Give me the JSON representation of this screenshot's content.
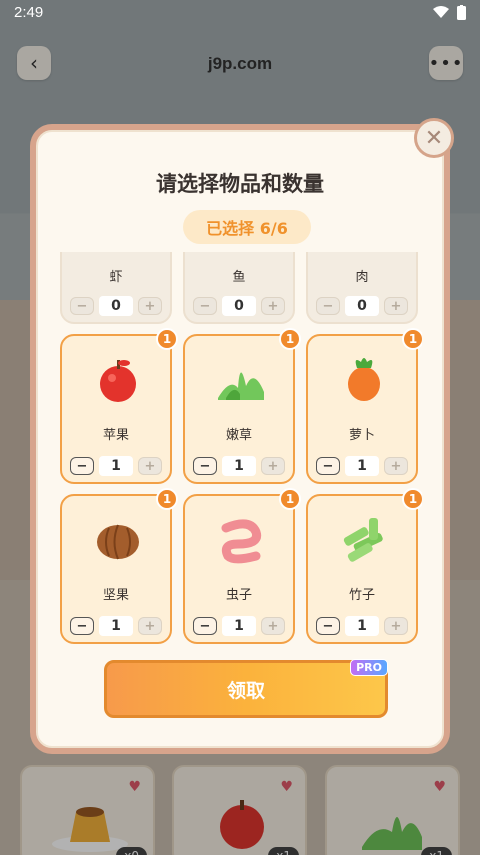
{
  "status_bar": {
    "time": "2:49"
  },
  "top_bar": {
    "domain": "j9p.com"
  },
  "dialog": {
    "title": "请选择物品和数量",
    "selected_text": "已选择 6/6",
    "claim_label": "领取",
    "pro_badge": "PRO",
    "partial_row": [
      {
        "name": "虾",
        "qty": "0"
      },
      {
        "name": "鱼",
        "qty": "0"
      },
      {
        "name": "肉",
        "qty": "0"
      }
    ],
    "items": [
      {
        "name": "苹果",
        "qty": "1",
        "badge": "1",
        "icon": "apple-icon"
      },
      {
        "name": "嫩草",
        "qty": "1",
        "badge": "1",
        "icon": "grass-icon"
      },
      {
        "name": "萝卜",
        "qty": "1",
        "badge": "1",
        "icon": "carrot-icon"
      },
      {
        "name": "坚果",
        "qty": "1",
        "badge": "1",
        "icon": "nut-icon"
      },
      {
        "name": "虫子",
        "qty": "1",
        "badge": "1",
        "icon": "worm-icon"
      },
      {
        "name": "竹子",
        "qty": "1",
        "badge": "1",
        "icon": "bamboo-icon"
      }
    ]
  },
  "inventory": [
    {
      "count": "x0",
      "icon": "pudding-icon"
    },
    {
      "count": "x1",
      "icon": "apple-icon"
    },
    {
      "count": "x1",
      "icon": "grass-icon"
    }
  ],
  "colors": {
    "accent": "#f08a2c",
    "selected_bg": "#fde9c8",
    "modal_frame": "#d7a48c"
  }
}
